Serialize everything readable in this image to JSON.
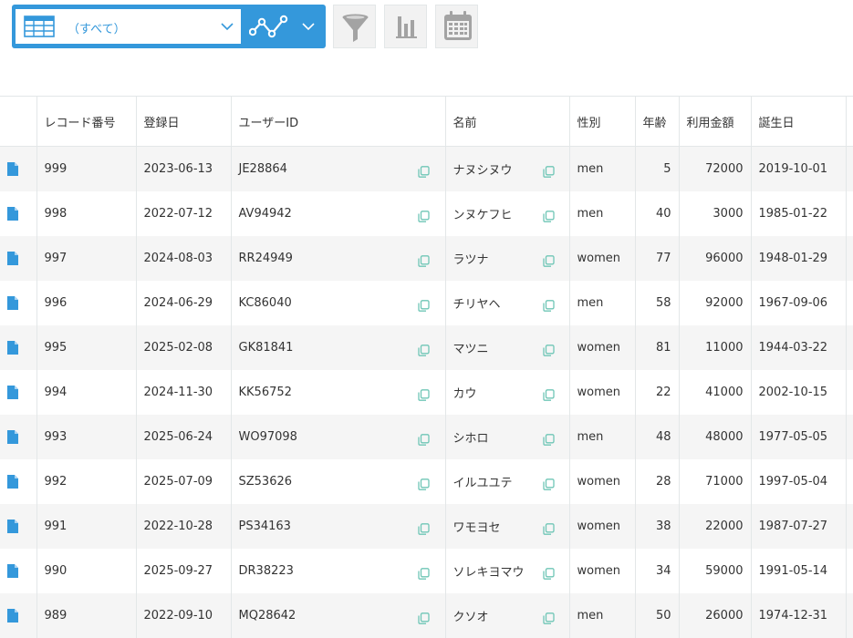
{
  "toolbar": {
    "view_selector": {
      "value": "（すべて）",
      "icon": "table-view-icon"
    },
    "graph_button": {
      "icon": "line-graph-icon"
    },
    "filter_button": {
      "icon": "funnel-icon"
    },
    "chart_button": {
      "icon": "bar-chart-icon"
    },
    "calendar_button": {
      "icon": "calendar-icon"
    }
  },
  "colors": {
    "accent": "#3498db",
    "row_alt": "#f5f5f5",
    "border": "#e3e7e8",
    "copy_icon": "#6fc6b6"
  },
  "table": {
    "columns": [
      "",
      "レコード番号",
      "登録日",
      "ユーザーID",
      "名前",
      "性別",
      "年齢",
      "利用金額",
      "誕生日"
    ],
    "rows": [
      [
        "999",
        "2023-06-13",
        "JE28864",
        "ナヌシヌウ",
        "men",
        "5",
        "72000",
        "2019-10-01"
      ],
      [
        "998",
        "2022-07-12",
        "AV94942",
        "ンヌケフヒ",
        "men",
        "40",
        "3000",
        "1985-01-22"
      ],
      [
        "997",
        "2024-08-03",
        "RR24949",
        "ラツナ",
        "women",
        "77",
        "96000",
        "1948-01-29"
      ],
      [
        "996",
        "2024-06-29",
        "KC86040",
        "チリヤヘ",
        "men",
        "58",
        "92000",
        "1967-09-06"
      ],
      [
        "995",
        "2025-02-08",
        "GK81841",
        "マツニ",
        "women",
        "81",
        "11000",
        "1944-03-22"
      ],
      [
        "994",
        "2024-11-30",
        "KK56752",
        "カウ",
        "women",
        "22",
        "41000",
        "2002-10-15"
      ],
      [
        "993",
        "2025-06-24",
        "WO97098",
        "シホロ",
        "men",
        "48",
        "48000",
        "1977-05-05"
      ],
      [
        "992",
        "2025-07-09",
        "SZ53626",
        "イルユユテ",
        "women",
        "28",
        "71000",
        "1997-05-04"
      ],
      [
        "991",
        "2022-10-28",
        "PS34163",
        "ワモヨセ",
        "women",
        "38",
        "22000",
        "1987-07-27"
      ],
      [
        "990",
        "2025-09-27",
        "DR38223",
        "ソレキヨマウ",
        "women",
        "34",
        "59000",
        "1991-05-14"
      ],
      [
        "989",
        "2022-09-10",
        "MQ28642",
        "クソオ",
        "men",
        "50",
        "26000",
        "1974-12-31"
      ]
    ]
  }
}
